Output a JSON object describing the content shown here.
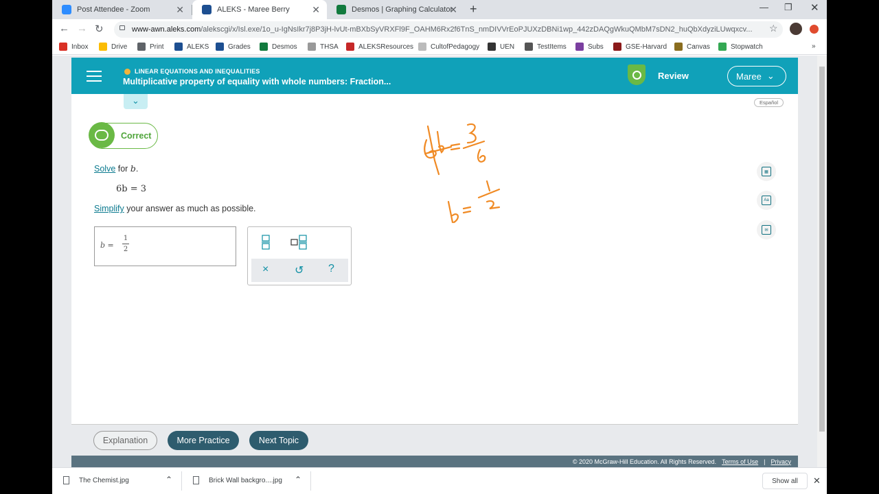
{
  "tabs": [
    {
      "title": "Post Attendee - Zoom",
      "color": "#2d8cff"
    },
    {
      "title": "ALEKS - Maree Berry",
      "color": "#1d4f91"
    },
    {
      "title": "Desmos | Graphing Calculator",
      "color": "#127a3e"
    }
  ],
  "address": {
    "host": "www-awn.aleks.com",
    "path": "/alekscgi/x/Isl.exe/1o_u-IgNsIkr7j8P3jH-lvUt-mBXbSyVRXFl9F_OAHM6Rx2f6TnS_nmDIVVrEoPJUXzDBNi1wp_442zDAQgWkuQMbM7sDN2_huQbXdyziLUwqxcv..."
  },
  "bookmarks": [
    "Inbox",
    "Drive",
    "Print",
    "ALEKS",
    "Grades",
    "Desmos",
    "THSA",
    "ALEKSResources",
    "CultofPedagogy",
    "UEN",
    "TestItems",
    "Subs",
    "GSE-Harvard",
    "Canvas",
    "Stopwatch"
  ],
  "header": {
    "topic": "LINEAR EQUATIONS AND INEQUALITIES",
    "subtopic": "Multiplicative property of equality with whole numbers: Fraction...",
    "review": "Review",
    "user": "Maree",
    "espanol": "Español"
  },
  "problem": {
    "status": "Correct",
    "solve_link": "Solve",
    "solve_rest": " for ",
    "variable": "b",
    "period": ".",
    "equation": "6b = 3",
    "simplify_link": "Simplify",
    "simplify_rest": " your answer as much as possible.",
    "answer_label": "b =",
    "answer_num": "1",
    "answer_den": "2"
  },
  "keypad": {
    "fraction": "fraction",
    "mixed": "mixed-number",
    "clear": "×",
    "undo": "↺",
    "help": "?"
  },
  "footer": {
    "explanation": "Explanation",
    "more_practice": "More Practice",
    "next_topic": "Next Topic",
    "copyright": "© 2020 McGraw-Hill Education. All Rights Reserved.",
    "terms": "Terms of Use",
    "sep": "|",
    "privacy": "Privacy"
  },
  "downloads": {
    "file1": "The Chemist.jpg",
    "file2": "Brick Wall backgro....jpg",
    "show_all": "Show all"
  }
}
